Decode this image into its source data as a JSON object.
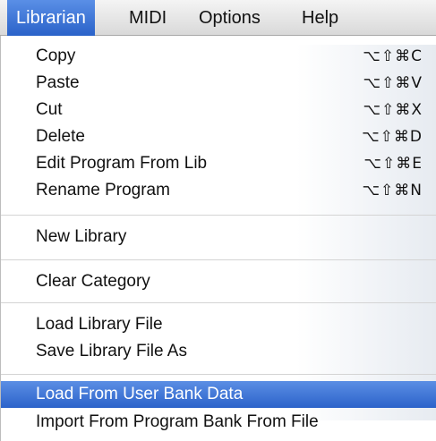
{
  "menubar": {
    "items": [
      {
        "label": "Librarian"
      },
      {
        "label": "MIDI"
      },
      {
        "label": "Options"
      },
      {
        "label": "Help"
      }
    ]
  },
  "menu": {
    "groups": [
      {
        "items": [
          {
            "label": "Copy",
            "shortcut": "⌥⇧⌘C"
          },
          {
            "label": "Paste",
            "shortcut": "⌥⇧⌘V"
          },
          {
            "label": "Cut",
            "shortcut": "⌥⇧⌘X"
          },
          {
            "label": "Delete",
            "shortcut": "⌥⇧⌘D"
          },
          {
            "label": "Edit Program From Lib",
            "shortcut": "⌥⇧⌘E"
          },
          {
            "label": "Rename Program",
            "shortcut": "⌥⇧⌘N"
          }
        ]
      },
      {
        "items": [
          {
            "label": "New Library"
          }
        ]
      },
      {
        "items": [
          {
            "label": "Clear Category"
          }
        ]
      },
      {
        "items": [
          {
            "label": "Load Library File"
          },
          {
            "label": "Save Library File As"
          }
        ]
      },
      {
        "items": [
          {
            "label": "Load From User Bank Data",
            "highlighted": true
          },
          {
            "label": "Import From Program Bank From File"
          }
        ]
      }
    ]
  },
  "colors": {
    "highlight": "#3d74d4",
    "text": "#111111",
    "separator": "#d4d4d4"
  }
}
